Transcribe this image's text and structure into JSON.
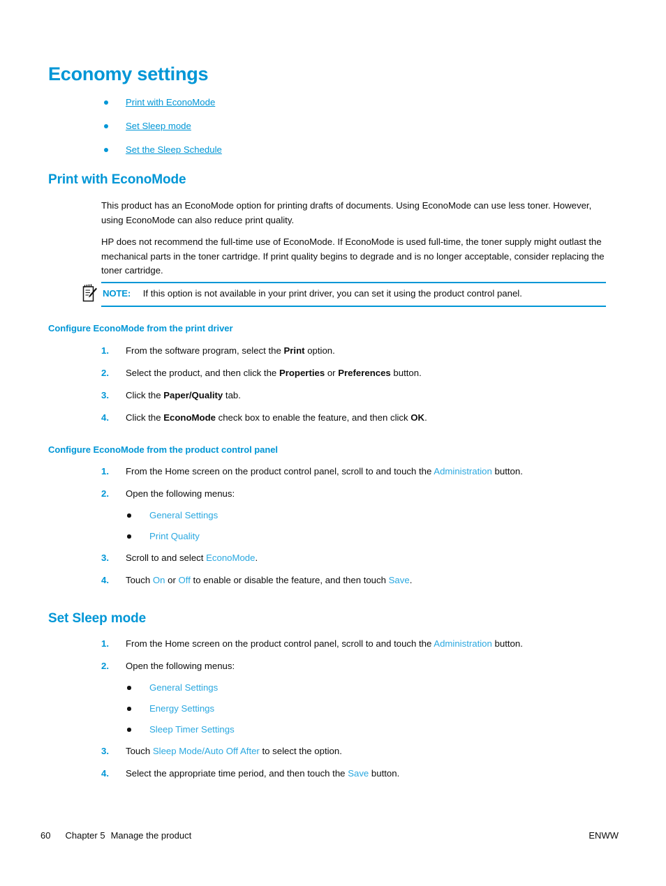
{
  "page": {
    "title": "Economy settings",
    "accent_color": "#0096d6",
    "ui_color": "#2aa8e0",
    "text_color": "#0d0d0d"
  },
  "toc": {
    "items": [
      {
        "label": "Print with EconoMode"
      },
      {
        "label": "Set Sleep mode"
      },
      {
        "label": "Set the Sleep Schedule"
      }
    ]
  },
  "econo": {
    "heading": "Print with EconoMode",
    "para1": "This product has an EconoMode option for printing drafts of documents. Using EconoMode can use less toner. However, using EconoMode can also reduce print quality.",
    "para2": "HP does not recommend the full-time use of EconoMode. If EconoMode is used full-time, the toner supply might outlast the mechanical parts in the toner cartridge. If print quality begins to degrade and is no longer acceptable, consider replacing the toner cartridge.",
    "note": {
      "icon": "note-pad-pencil-icon",
      "label": "NOTE:",
      "text": "If this option is not available in your print driver, you can set it using the product control panel."
    },
    "driver": {
      "heading": "Configure EconoMode from the print driver",
      "steps": [
        {
          "number": "1.",
          "parts": [
            {
              "t": "From the software program, select the ",
              "s": "plain"
            },
            {
              "t": "Print",
              "s": "bold"
            },
            {
              "t": " option.",
              "s": "plain"
            }
          ]
        },
        {
          "number": "2.",
          "parts": [
            {
              "t": "Select the product, and then click the ",
              "s": "plain"
            },
            {
              "t": "Properties",
              "s": "bold"
            },
            {
              "t": " or ",
              "s": "plain"
            },
            {
              "t": "Preferences",
              "s": "bold"
            },
            {
              "t": " button.",
              "s": "plain"
            }
          ]
        },
        {
          "number": "3.",
          "parts": [
            {
              "t": "Click the ",
              "s": "plain"
            },
            {
              "t": "Paper/Quality",
              "s": "bold"
            },
            {
              "t": " tab.",
              "s": "plain"
            }
          ]
        },
        {
          "number": "4.",
          "parts": [
            {
              "t": "Click the ",
              "s": "plain"
            },
            {
              "t": "EconoMode",
              "s": "bold"
            },
            {
              "t": " check box to enable the feature, and then click ",
              "s": "plain"
            },
            {
              "t": "OK",
              "s": "bold"
            },
            {
              "t": ".",
              "s": "plain"
            }
          ]
        }
      ]
    },
    "panel": {
      "heading": "Configure EconoMode from the product control panel",
      "steps": [
        {
          "number": "1.",
          "parts": [
            {
              "t": "From the Home screen on the product control panel, scroll to and touch the ",
              "s": "plain"
            },
            {
              "t": "Administration",
              "s": "ui"
            },
            {
              "t": " button.",
              "s": "plain"
            }
          ]
        },
        {
          "number": "2.",
          "parts": [
            {
              "t": "Open the following menus:",
              "s": "plain"
            }
          ],
          "sub": [
            {
              "label": "General Settings"
            },
            {
              "label": "Print Quality"
            }
          ]
        },
        {
          "number": "3.",
          "parts": [
            {
              "t": "Scroll to and select ",
              "s": "plain"
            },
            {
              "t": "EconoMode",
              "s": "ui"
            },
            {
              "t": ".",
              "s": "plain"
            }
          ]
        },
        {
          "number": "4.",
          "parts": [
            {
              "t": "Touch ",
              "s": "plain"
            },
            {
              "t": "On",
              "s": "ui"
            },
            {
              "t": " or ",
              "s": "plain"
            },
            {
              "t": "Off",
              "s": "ui"
            },
            {
              "t": " to enable or disable the feature, and then touch ",
              "s": "plain"
            },
            {
              "t": "Save",
              "s": "ui"
            },
            {
              "t": ".",
              "s": "plain"
            }
          ]
        }
      ]
    }
  },
  "sleep": {
    "heading": "Set Sleep mode",
    "steps": [
      {
        "number": "1.",
        "parts": [
          {
            "t": "From the Home screen on the product control panel, scroll to and touch the ",
            "s": "plain"
          },
          {
            "t": "Administration",
            "s": "ui"
          },
          {
            "t": " button.",
            "s": "plain"
          }
        ]
      },
      {
        "number": "2.",
        "parts": [
          {
            "t": "Open the following menus:",
            "s": "plain"
          }
        ],
        "sub": [
          {
            "label": "General Settings"
          },
          {
            "label": "Energy Settings"
          },
          {
            "label": "Sleep Timer Settings"
          }
        ]
      },
      {
        "number": "3.",
        "parts": [
          {
            "t": "Touch ",
            "s": "plain"
          },
          {
            "t": "Sleep Mode/Auto Off After",
            "s": "ui"
          },
          {
            "t": " to select the option.",
            "s": "plain"
          }
        ]
      },
      {
        "number": "4.",
        "parts": [
          {
            "t": "Select the appropriate time period, and then touch the ",
            "s": "plain"
          },
          {
            "t": "Save",
            "s": "ui"
          },
          {
            "t": " button.",
            "s": "plain"
          }
        ]
      }
    ]
  },
  "footer": {
    "page_number": "60",
    "chapter": "Chapter 5",
    "chapter_title": "Manage the product",
    "locale": "ENWW"
  }
}
